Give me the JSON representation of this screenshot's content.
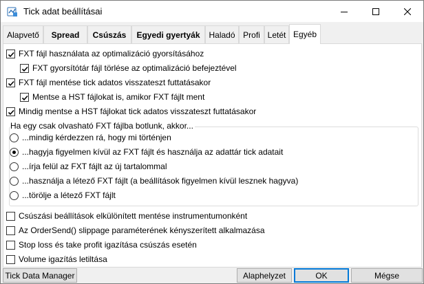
{
  "window": {
    "title": "Tick adat beállításai",
    "icon": "tick-data-app-icon"
  },
  "tabs": [
    {
      "label": "Alapvető",
      "active": false
    },
    {
      "label": "Spread",
      "active": false
    },
    {
      "label": "Csúszás",
      "active": false
    },
    {
      "label": "Egyedi gyertyák",
      "active": false
    },
    {
      "label": "Haladó",
      "active": false
    },
    {
      "label": "Profi",
      "active": false
    },
    {
      "label": "Letét",
      "active": false
    },
    {
      "label": "Egyéb",
      "active": true
    }
  ],
  "options": {
    "use_fxt": {
      "label": "FXT fájl használata az optimalizáció gyorsításához",
      "checked": true
    },
    "delete_fxt_cache": {
      "label": "FXT gyorsítótár fájl törlése az optimalizáció befejeztével",
      "checked": true
    },
    "save_fxt": {
      "label": "FXT fájl mentése tick adatos visszateszt futtatásakor",
      "checked": true
    },
    "save_hst": {
      "label": "Mentse a HST fájlokat is, amikor FXT fájlt ment",
      "checked": true
    },
    "always_save_hst": {
      "label": "Mindig mentse a HST fájlokat tick adatos visszateszt futtatásakor",
      "checked": true
    }
  },
  "readonly_group": {
    "title": "Ha egy csak olvasható FXT fájlba botlunk, akkor...",
    "items": [
      {
        "label": "...mindig kérdezzen rá, hogy mi történjen",
        "selected": false
      },
      {
        "label": "...hagyja figyelmen kívül az FXT fájlt és használja az adattár tick adatait",
        "selected": true
      },
      {
        "label": "...írja felül az FXT fájlt az új tartalommal",
        "selected": false
      },
      {
        "label": "...használja a létező FXT fájlt (a beállítások figyelmen kívül lesznek hagyva)",
        "selected": false
      },
      {
        "label": "...törölje a létező FXT fájlt",
        "selected": false
      }
    ]
  },
  "extra_options": [
    {
      "label": "Csúszási beállítások elkülönített mentése instrumentumonként",
      "checked": false
    },
    {
      "label": "Az OrderSend() slippage paraméterének kényszerített alkalmazása",
      "checked": false
    },
    {
      "label": "Stop loss és take profit igazítása csúszás esetén",
      "checked": false
    },
    {
      "label": "Volume igazítás letiltása",
      "checked": false
    }
  ],
  "buttons": {
    "tick_data_manager": "Tick Data Manager",
    "defaults": "Alaphelyzet",
    "ok": "OK",
    "cancel": "Mégse"
  }
}
